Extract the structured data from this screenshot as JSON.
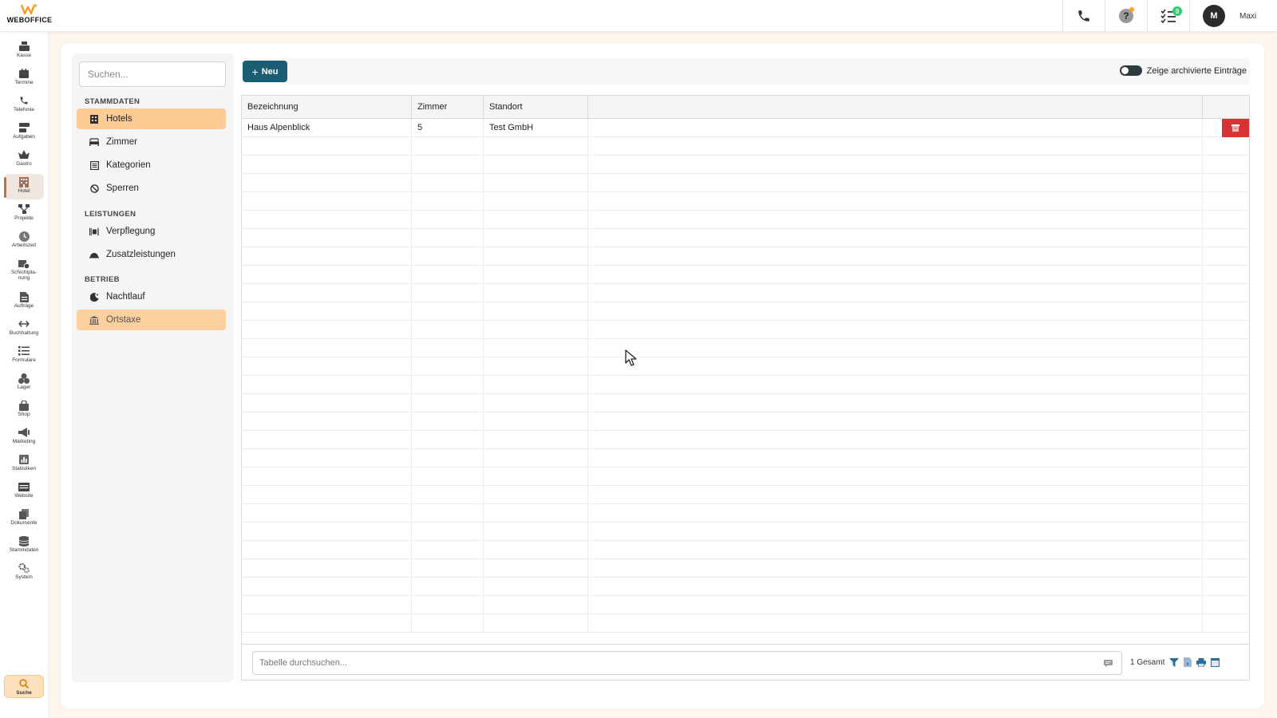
{
  "app": {
    "logo_text": "WEBOFFICE",
    "accent_color": "#fdcb96",
    "primary_button_color": "#1b5e74"
  },
  "topbar": {
    "icons": [
      "phone-icon",
      "help-icon",
      "tasks-icon"
    ],
    "tasks_count": "0",
    "user": {
      "initial": "M",
      "name": "Maxi"
    }
  },
  "rail": {
    "items": [
      {
        "label": "Kasse",
        "icon": "cash-register-icon"
      },
      {
        "label": "Termine",
        "icon": "calendar-icon"
      },
      {
        "label": "Telefonie",
        "icon": "phone-icon"
      },
      {
        "label": "Aufgaben",
        "icon": "tasks-icon"
      },
      {
        "label": "Gastro",
        "icon": "crown-icon"
      },
      {
        "label": "Hotel",
        "icon": "hotel-icon",
        "active": true
      },
      {
        "label": "Projekte",
        "icon": "project-icon"
      },
      {
        "label": "Arbeitszeit",
        "icon": "clock-icon"
      },
      {
        "label": "Schichtpla-\nnung",
        "icon": "shift-icon"
      },
      {
        "label": "Aufträge",
        "icon": "order-icon"
      },
      {
        "label": "Buchhaltung",
        "icon": "exchange-icon"
      },
      {
        "label": "Formulare",
        "icon": "form-icon"
      },
      {
        "label": "Lager",
        "icon": "boxes-icon"
      },
      {
        "label": "Shop",
        "icon": "bag-icon"
      },
      {
        "label": "Marketing",
        "icon": "megaphone-icon"
      },
      {
        "label": "Statistiken",
        "icon": "chart-icon"
      },
      {
        "label": "Website",
        "icon": "website-icon"
      },
      {
        "label": "Dokumente",
        "icon": "documents-icon"
      },
      {
        "label": "Stammdaten",
        "icon": "database-icon"
      },
      {
        "label": "System",
        "icon": "gears-icon"
      }
    ],
    "search_label": "Suche"
  },
  "sidepanel": {
    "search_placeholder": "Suchen...",
    "sections": [
      {
        "title": "STAMMDATEN",
        "items": [
          {
            "label": "Hotels",
            "icon": "hotel-icon",
            "active": true
          },
          {
            "label": "Zimmer",
            "icon": "bed-icon"
          },
          {
            "label": "Kategorien",
            "icon": "list-icon"
          },
          {
            "label": "Sperren",
            "icon": "block-icon"
          }
        ]
      },
      {
        "title": "LEISTUNGEN",
        "items": [
          {
            "label": "Verpflegung",
            "icon": "utensils-icon"
          },
          {
            "label": "Zusatzleistungen",
            "icon": "service-bell-icon"
          }
        ]
      },
      {
        "title": "BETRIEB",
        "items": [
          {
            "label": "Nachtlauf",
            "icon": "moon-icon"
          },
          {
            "label": "Ortstaxe",
            "icon": "landmark-icon",
            "hovered": true
          }
        ]
      }
    ]
  },
  "toolbar": {
    "new_label": "Neu",
    "archive_label": "Zeige archivierte Einträge"
  },
  "table": {
    "columns": [
      "Bezeichnung",
      "Zimmer",
      "Standort"
    ],
    "rows": [
      {
        "Bezeichnung": "Haus Alpenblick",
        "Zimmer": "5",
        "Standort": "Test GmbH"
      }
    ],
    "search_placeholder": "Tabelle durchsuchen...",
    "total_label": "1 Gesamt"
  }
}
